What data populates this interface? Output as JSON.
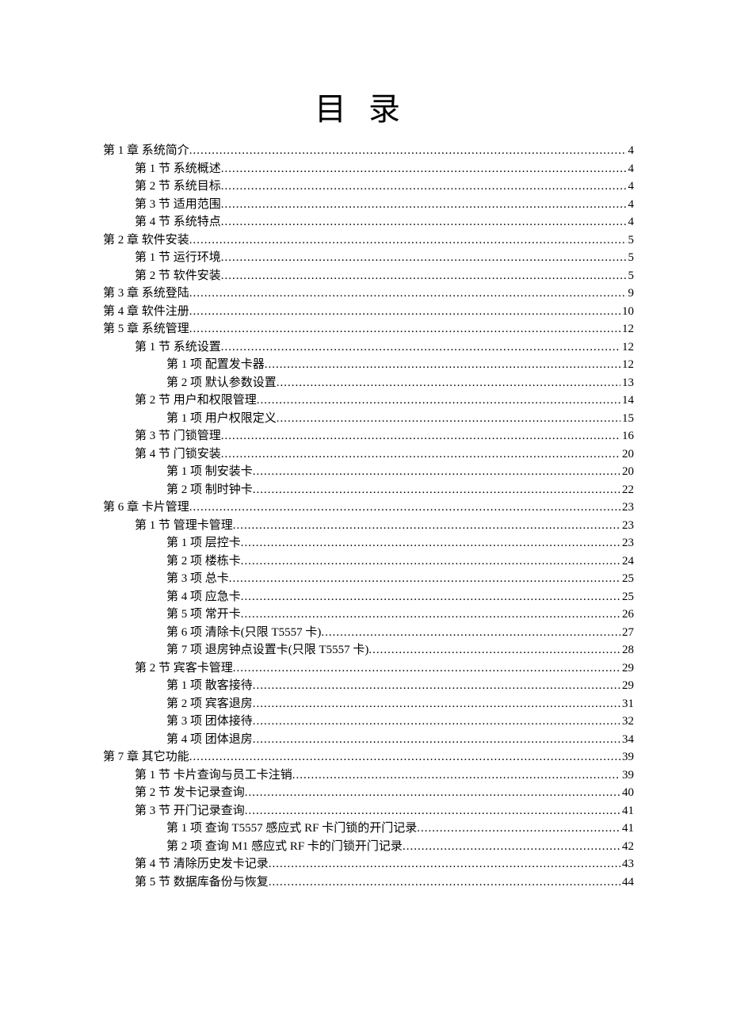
{
  "title": "目录",
  "toc": [
    {
      "level": 0,
      "label": "第 1 章  系统简介",
      "page": "4"
    },
    {
      "level": 1,
      "label": "第 1 节  系统概述",
      "page": "4"
    },
    {
      "level": 1,
      "label": "第 2 节  系统目标",
      "page": "4"
    },
    {
      "level": 1,
      "label": "第 3 节  适用范围",
      "page": "4"
    },
    {
      "level": 1,
      "label": "第 4 节  系统特点",
      "page": "4"
    },
    {
      "level": 0,
      "label": "第 2 章  软件安装",
      "page": "5"
    },
    {
      "level": 1,
      "label": "第 1 节  运行环境",
      "page": "5"
    },
    {
      "level": 1,
      "label": "第 2 节  软件安装",
      "page": "5"
    },
    {
      "level": 0,
      "label": "第 3 章  系统登陆",
      "page": "9"
    },
    {
      "level": 0,
      "label": "第 4 章  软件注册",
      "page": "10"
    },
    {
      "level": 0,
      "label": "第 5 章  系统管理",
      "page": "12"
    },
    {
      "level": 1,
      "label": "第 1 节  系统设置",
      "page": "12"
    },
    {
      "level": 2,
      "label": "第 1 项  配置发卡器",
      "page": "12"
    },
    {
      "level": 2,
      "label": "第 2 项  默认参数设置",
      "page": "13"
    },
    {
      "level": 1,
      "label": "第 2 节  用户和权限管理",
      "page": "14"
    },
    {
      "level": 2,
      "label": "第 1 项  用户权限定义",
      "page": "15"
    },
    {
      "level": 1,
      "label": "第 3 节  门锁管理",
      "page": "16"
    },
    {
      "level": 1,
      "label": "第 4 节  门锁安装",
      "page": "20"
    },
    {
      "level": 2,
      "label": "第 1 项  制安装卡",
      "page": "20"
    },
    {
      "level": 2,
      "label": "第 2 项  制时钟卡",
      "page": "22"
    },
    {
      "level": 0,
      "label": "第 6 章  卡片管理",
      "page": "23"
    },
    {
      "level": 1,
      "label": "第 1 节  管理卡管理",
      "page": "23"
    },
    {
      "level": 2,
      "label": "第 1 项  层控卡",
      "page": "23"
    },
    {
      "level": 2,
      "label": "第 2 项  楼栋卡",
      "page": "24"
    },
    {
      "level": 2,
      "label": "第 3 项  总卡",
      "page": "25"
    },
    {
      "level": 2,
      "label": "第 4 项  应急卡",
      "page": "25"
    },
    {
      "level": 2,
      "label": "第 5 项  常开卡",
      "page": "26"
    },
    {
      "level": 2,
      "label": "第 6 项  清除卡(只限 T5557 卡)",
      "page": "27"
    },
    {
      "level": 2,
      "label": "第 7 项  退房钟点设置卡(只限 T5557 卡)",
      "page": "28"
    },
    {
      "level": 1,
      "label": "第 2 节  宾客卡管理",
      "page": "29"
    },
    {
      "level": 2,
      "label": "第 1 项  散客接待",
      "page": "29"
    },
    {
      "level": 2,
      "label": "第 2 项  宾客退房",
      "page": "31"
    },
    {
      "level": 2,
      "label": "第 3 项  团体接待",
      "page": "32"
    },
    {
      "level": 2,
      "label": "第 4 项  团体退房",
      "page": "34"
    },
    {
      "level": 0,
      "label": "第 7 章  其它功能",
      "page": "39"
    },
    {
      "level": 1,
      "label": "第 1 节  卡片查询与员工卡注销",
      "page": "39"
    },
    {
      "level": 1,
      "label": "第 2 节  发卡记录查询",
      "page": "40"
    },
    {
      "level": 1,
      "label": "第 3 节  开门记录查询",
      "page": "41"
    },
    {
      "level": 2,
      "label": "第 1 项  查询 T5557 感应式 RF 卡门锁的开门记录 ",
      "page": "41"
    },
    {
      "level": 2,
      "label": "第 2 项  查询 M1 感应式 RF 卡的门锁开门记录 ",
      "page": "42"
    },
    {
      "level": 1,
      "label": "第 4 节  清除历史发卡记录",
      "page": "43"
    },
    {
      "level": 1,
      "label": "第 5 节  数据库备份与恢复",
      "page": "44"
    }
  ]
}
